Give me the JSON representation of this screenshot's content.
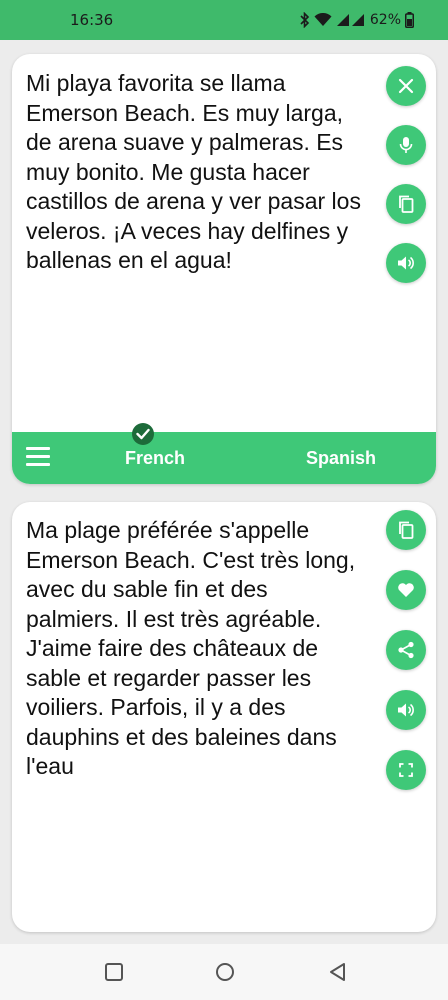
{
  "status_bar": {
    "time": "16:36",
    "battery": "62%",
    "icons": [
      "bluetooth-icon",
      "wifi-icon",
      "signal-icon",
      "battery-icon"
    ]
  },
  "source_card": {
    "text": "Mi playa favorita se llama Emerson Beach. Es muy larga, de arena suave y palmeras. Es muy bonito. Me gusta hacer castillos de arena y ver pasar los veleros. ¡A veces hay delfines y ballenas en el agua!",
    "buttons": [
      "close-icon",
      "microphone-icon",
      "copy-icon",
      "speaker-icon"
    ]
  },
  "language_bar": {
    "source_language": "French",
    "target_language": "Spanish"
  },
  "target_card": {
    "text": "Ma plage préférée s'appelle Emerson Beach. C'est très long, avec du sable fin et des palmiers. Il est très agréable. J'aime faire des châteaux de sable et regarder passer les voiliers. Parfois, il y a des dauphins et des baleines dans l'eau",
    "buttons": [
      "copy-icon",
      "heart-icon",
      "share-icon",
      "speaker-icon",
      "fullscreen-icon"
    ]
  },
  "nav_bar": {
    "buttons": [
      "recents-icon",
      "home-icon",
      "back-icon"
    ]
  },
  "colors": {
    "accent": "#3fc878",
    "status_bar": "#3fba6b",
    "check_badge": "#1d6b3a"
  }
}
